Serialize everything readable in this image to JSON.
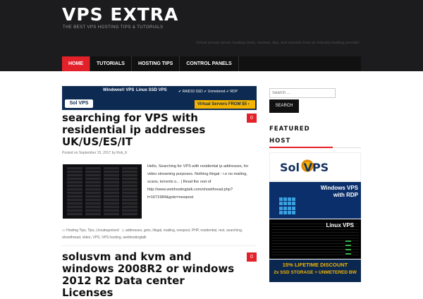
{
  "site": {
    "title": "VPS EXTRA",
    "tagline": "THE BEST VPS HOSTING TIPS & TUTORIALS",
    "description": "Virtual private server hosting news, reviews, tips, and tutorials from an industry-leading provider"
  },
  "nav": {
    "items": [
      {
        "label": "HOME",
        "active": true
      },
      {
        "label": "TUTORIALS",
        "active": false
      },
      {
        "label": "HOSTING TIPS",
        "active": false
      },
      {
        "label": "CONTROL PANELS",
        "active": false
      }
    ]
  },
  "ad_banner": {
    "logo": "Sol VPS",
    "windows": "Windows® VPS",
    "linux": "Linux SSD VPS",
    "features": "✔ RAID10 SSD   ✔ Unmetered   ✔ RDP",
    "cta": "Virtual Servers FROM $5 ›"
  },
  "posts": [
    {
      "title": "searching for VPS with residential ip addresses UK/US/ES/IT",
      "comments": "0",
      "meta": "Posted on September 15, 2017 by Rob_K",
      "excerpt": "Hello, Searching for VPS with residential ip addresses, for video streaming purposes. Nothing illegal - i.e no mailing, scans, torrents o... | Read the rest of http://www.webhostingtalk.com/showthread.php?t=1671984&goto=newpost",
      "categories": "Hosting Tips, Tips, Uncategorized",
      "tags": "addresses, goto, illegal, mailing, newpost, PHP, residential, rest, searching, showthread, video, VPS, VPS hosting, webhostingtalk"
    },
    {
      "title": "solusvm and kvm and windows 2008R2 or windows 2012 R2 Data center Licenses",
      "comments": "0"
    }
  ],
  "sidebar": {
    "search_placeholder": "Search ...",
    "search_button": "SEARCH",
    "featured_title": "FEATURED HOST",
    "solvps": "Sol VPS",
    "windows_ad": "Windows VPS with RDP",
    "linux_ad": "Linux VPS",
    "promo_line1": "15% LIFETIME DISCOUNT",
    "promo_line2": "2x SSD STORAGE + UNMETERED BW"
  },
  "colors": {
    "accent": "#e3212b",
    "header_bg": "#1c1c1e",
    "brand_navy": "#0d2a52",
    "promo_gold": "#f4b400"
  }
}
